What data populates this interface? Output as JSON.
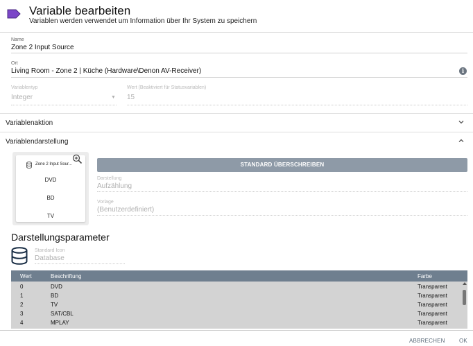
{
  "header": {
    "title": "Variable bearbeiten",
    "subtitle": "Variablen werden verwendet um Information über Ihr System zu speichern",
    "icon": "tag-icon",
    "icon_color": "#7b46c8"
  },
  "fields": {
    "name": {
      "label": "Name",
      "value": "Zone 2 Input Source"
    },
    "ort": {
      "label": "Ort",
      "value": "Living Room - Zone 2 | Küche (Hardware\\Denon AV-Receiver)"
    },
    "variablentyp": {
      "label": "Variablentyp",
      "value": "Integer"
    },
    "wert": {
      "label": "Wert (Beaktiviert für Statusvariablen)",
      "value": "15"
    }
  },
  "sections": {
    "aktion": "Variablenaktion",
    "darstellung": "Variablendarstellung"
  },
  "preview": {
    "title": "Zone 2 Input Sour...",
    "options": [
      "DVD",
      "BD",
      "TV"
    ]
  },
  "override_button": "STANDARD ÜBERSCHREIBEN",
  "darstellung_field": {
    "label": "Darstellung",
    "value": "Aufzählung"
  },
  "vorlage_field": {
    "label": "Vorlage",
    "value": "(Benutzerdefiniert)"
  },
  "parameters": {
    "title": "Darstellungsparameter",
    "icon_label": "Standard Icon",
    "icon_value": "Database"
  },
  "table": {
    "headers": [
      "Wert",
      "Beschriftung",
      "Farbe"
    ],
    "rows": [
      {
        "wert": "0",
        "beschriftung": "DVD",
        "farbe": "Transparent"
      },
      {
        "wert": "1",
        "beschriftung": "BD",
        "farbe": "Transparent"
      },
      {
        "wert": "2",
        "beschriftung": "TV",
        "farbe": "Transparent"
      },
      {
        "wert": "3",
        "beschriftung": "SAT/CBL",
        "farbe": "Transparent"
      },
      {
        "wert": "4",
        "beschriftung": "MPLAY",
        "farbe": "Transparent"
      }
    ]
  },
  "footer": {
    "cancel": "ABBRECHEN",
    "ok": "OK"
  },
  "colors": {
    "button": "#8e9aa7",
    "table_header": "#6f7f8f",
    "table_body": "#d3d3d3"
  }
}
